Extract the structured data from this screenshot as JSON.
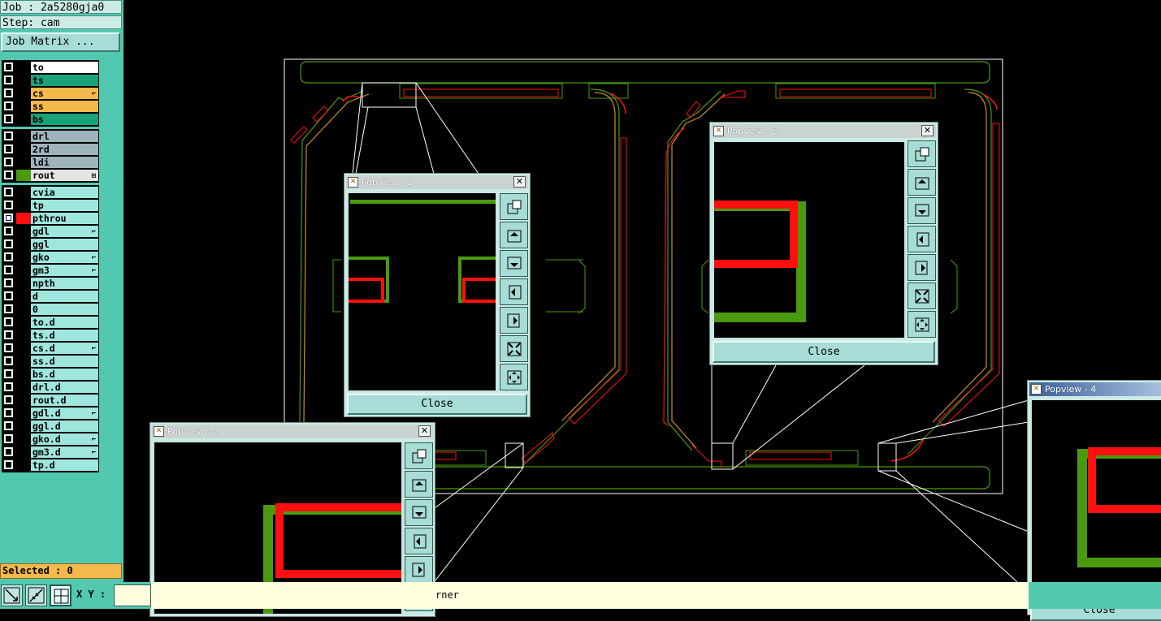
{
  "header": {
    "job": "Job : 2a5280gja0",
    "step": "Step: cam",
    "job_matrix_button": "Job Matrix ..."
  },
  "layers": {
    "board": [
      {
        "name": "to",
        "bg": "#ffffff",
        "checked": false
      },
      {
        "name": "ts",
        "bg": "#1aa27a",
        "checked": false
      },
      {
        "name": "cs",
        "bg": "#f5b84a",
        "checked": false,
        "mark": "⌐"
      },
      {
        "name": "ss",
        "bg": "#f5b84a",
        "checked": false
      },
      {
        "name": "bs",
        "bg": "#1aa27a",
        "checked": false
      }
    ],
    "drill": [
      {
        "name": "drl",
        "bg": "#9fb3bd",
        "checked": false
      },
      {
        "name": "2rd",
        "bg": "#9fb3bd",
        "checked": false
      },
      {
        "name": "ldi",
        "bg": "#9fb3bd",
        "checked": false
      },
      {
        "name": "rout",
        "bg": "#e4e4e4",
        "checked": false,
        "swatch": "#4a9a10",
        "mark": "⊞"
      }
    ],
    "misc": [
      {
        "name": "cvia",
        "bg": "#9fe6de",
        "checked": false
      },
      {
        "name": "tp",
        "bg": "#9fe6de",
        "checked": false
      },
      {
        "name": "pthrou",
        "bg": "#9fe6de",
        "checked": true,
        "swatch": "#ff1010",
        "selected": true
      },
      {
        "name": "gdl",
        "bg": "#9fe6de",
        "checked": false,
        "mark": "⌐"
      },
      {
        "name": "ggl",
        "bg": "#9fe6de",
        "checked": false
      },
      {
        "name": "gko",
        "bg": "#9fe6de",
        "checked": false,
        "mark": "⌐"
      },
      {
        "name": "gm3",
        "bg": "#9fe6de",
        "checked": false,
        "mark": "⌐"
      },
      {
        "name": "npth",
        "bg": "#9fe6de",
        "checked": false
      },
      {
        "name": "d",
        "bg": "#9fe6de",
        "checked": false
      },
      {
        "name": "0",
        "bg": "#9fe6de",
        "checked": false
      },
      {
        "name": "to.d",
        "bg": "#9fe6de",
        "checked": false
      },
      {
        "name": "ts.d",
        "bg": "#9fe6de",
        "checked": false
      },
      {
        "name": "cs.d",
        "bg": "#9fe6de",
        "checked": false,
        "mark": "⌐"
      },
      {
        "name": "ss.d",
        "bg": "#9fe6de",
        "checked": false
      },
      {
        "name": "bs.d",
        "bg": "#9fe6de",
        "checked": false
      },
      {
        "name": "drl.d",
        "bg": "#9fe6de",
        "checked": false
      },
      {
        "name": "rout.d",
        "bg": "#9fe6de",
        "checked": false
      },
      {
        "name": "gdl.d",
        "bg": "#9fe6de",
        "checked": false,
        "mark": "⌐"
      },
      {
        "name": "ggl.d",
        "bg": "#9fe6de",
        "checked": false
      },
      {
        "name": "gko.d",
        "bg": "#9fe6de",
        "checked": false,
        "mark": "⌐"
      },
      {
        "name": "gm3.d",
        "bg": "#9fe6de",
        "checked": false,
        "mark": "⌐"
      },
      {
        "name": "tp.d",
        "bg": "#9fe6de",
        "checked": false
      }
    ]
  },
  "selected_label": "Selected : 0",
  "bottom": {
    "xy_label": "X Y :",
    "xy_value": "",
    "status_text": "rner"
  },
  "popups": {
    "p1": {
      "title": "Popview - 1",
      "close_label": "Close"
    },
    "p2": {
      "title": "Popview - 2",
      "close_label": "Close"
    },
    "p3": {
      "title": "Popview - 3",
      "close_label": "Close"
    },
    "p4": {
      "title": "Popview - 4",
      "close_label": "Close"
    }
  },
  "colors": {
    "rout_green": "#4a9a10",
    "layer_red": "#ff1010",
    "overlap_orange": "#c89030",
    "panel_teal": "#52c8b0"
  }
}
